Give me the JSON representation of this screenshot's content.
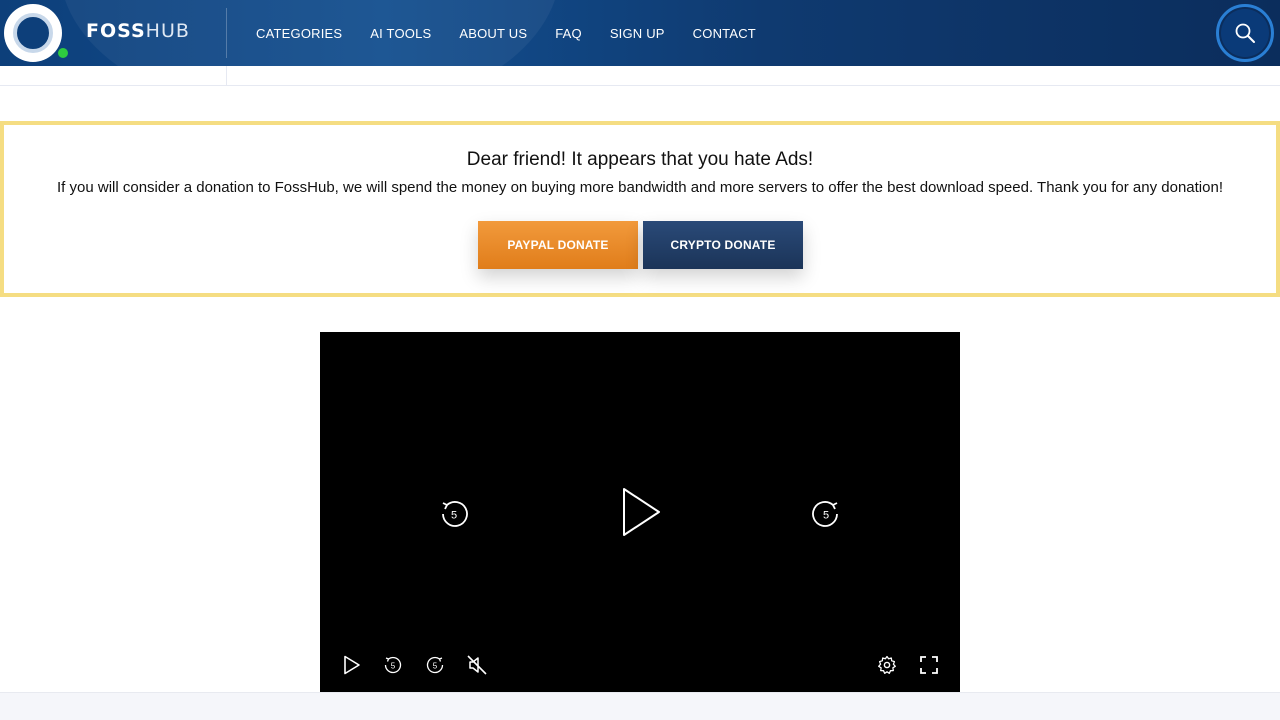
{
  "header": {
    "brand_bold": "FOSS",
    "brand_light": "HUB",
    "nav": [
      {
        "label": "CATEGORIES"
      },
      {
        "label": "AI TOOLS"
      },
      {
        "label": "ABOUT US"
      },
      {
        "label": "FAQ"
      },
      {
        "label": "SIGN UP"
      },
      {
        "label": "CONTACT"
      }
    ],
    "search_icon": "search-icon",
    "colors": {
      "header_bg": "#0d3f7a",
      "online_dot": "#2ecc40",
      "search_ring": "#2a7fd4"
    }
  },
  "donation": {
    "title": "Dear friend! It appears that you hate Ads!",
    "message": "If you will consider a donation to FossHub, we will spend the money on buying more bandwidth and more servers to offer the best download speed. Thank you for any donation!",
    "paypal_label": "PAYPAL DONATE",
    "crypto_label": "CRYPTO DONATE",
    "colors": {
      "border": "#f5dd82",
      "paypal": "#e88a2a",
      "crypto": "#1f3a63"
    }
  },
  "video_player": {
    "skip_seconds": "5",
    "controls": [
      "play-icon",
      "rewind-5-icon",
      "forward-5-icon",
      "muted-icon",
      "settings-icon",
      "fullscreen-icon"
    ],
    "muted": true
  }
}
